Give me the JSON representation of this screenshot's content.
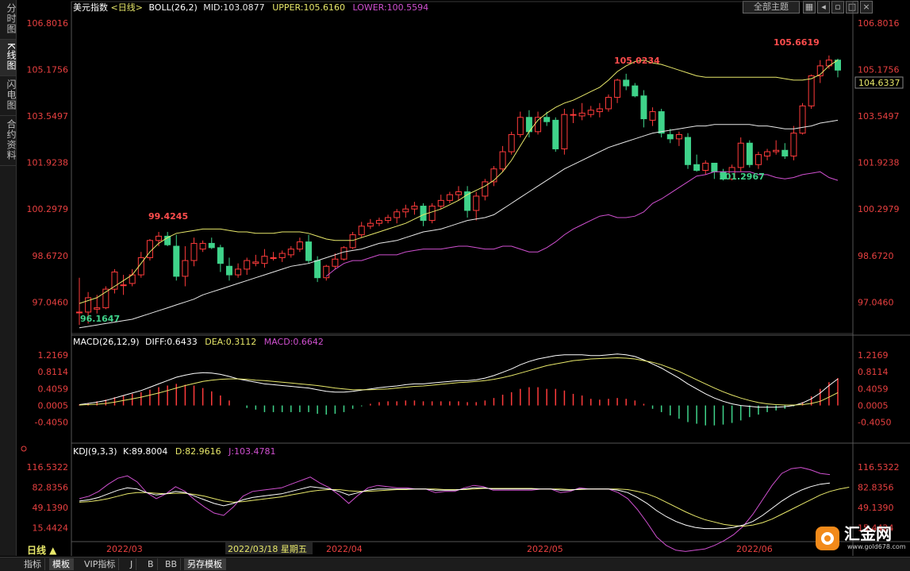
{
  "left_tabs": [
    "分时图",
    "K线图",
    "闪电图",
    "合约资料"
  ],
  "active_left_tab": 1,
  "top_buttons": {
    "theme": "全部主题",
    "icons": [
      "grid-icon",
      "prev-icon",
      "restore-icon",
      "maximize-icon",
      "close-icon"
    ]
  },
  "main_header": {
    "name": "美元指数",
    "period": "<日线>",
    "boll": "BOLL(26,2)",
    "mid": "MID:103.0877",
    "upper": "UPPER:105.6160",
    "lower": "LOWER:100.5594"
  },
  "macd_header": {
    "name": "MACD(26,12,9)",
    "diff": "DIFF:0.6433",
    "dea": "DEA:0.3112",
    "macd": "MACD:0.6642"
  },
  "kdj_header": {
    "name": "KDJ(9,3,3)",
    "k": "K:89.8004",
    "d": "D:82.9616",
    "j": "J:103.4781"
  },
  "annotations": {
    "high1": "99.4245",
    "high2": "105.0234",
    "high3": "105.6619",
    "low1": "96.1647",
    "low2": "101.2967",
    "last_price": "104.6337"
  },
  "x_axis": {
    "period_label": "日线 ▲",
    "months": [
      "2022/03",
      "2022/04",
      "2022/05",
      "2022/06"
    ],
    "cursor_date": "2022/03/18 星期五"
  },
  "bottom_tabs": [
    "指标",
    "模板",
    "VIP指标",
    "J",
    "B",
    "BB",
    "另存模板"
  ],
  "active_bottom_tab": 1,
  "logo": {
    "text": "汇金网",
    "url": "www.gold678.com"
  },
  "colors": {
    "up": "#ff3b3b",
    "down": "#3fd38a",
    "mid": "#e8e8e8",
    "upper": "#e8e86a",
    "lower": "#d050d0",
    "k_line": "#ffffff",
    "d_line": "#e8e86a",
    "j_line": "#d050d0",
    "axis_text": "#e84040"
  },
  "chart_data": [
    {
      "type": "candlestick",
      "title": "美元指数 <日线>",
      "y_ticks": [
        "106.8016",
        "105.1756",
        "103.5497",
        "101.9238",
        "100.2979",
        "98.6720",
        "97.0460"
      ],
      "ylim": [
        95.95,
        107.1
      ],
      "ohlc": [
        [
          96.7,
          97.9,
          96.25,
          96.7
        ],
        [
          96.7,
          97.4,
          96.3,
          97.2
        ],
        [
          96.8,
          97.3,
          96.65,
          96.85
        ],
        [
          96.85,
          97.6,
          96.8,
          97.5
        ],
        [
          97.5,
          98.2,
          97.35,
          98.1
        ],
        [
          97.65,
          98.0,
          97.3,
          97.65
        ],
        [
          97.7,
          98.2,
          97.6,
          98.0
        ],
        [
          98.0,
          98.8,
          97.9,
          98.6
        ],
        [
          98.6,
          99.25,
          98.5,
          99.2
        ],
        [
          99.2,
          99.5,
          99.0,
          99.35
        ],
        [
          99.35,
          99.5,
          99.0,
          99.05
        ],
        [
          99.0,
          99.4,
          97.8,
          97.95
        ],
        [
          97.95,
          99.0,
          97.6,
          98.5
        ],
        [
          98.5,
          99.3,
          98.3,
          99.1
        ],
        [
          98.9,
          99.2,
          98.8,
          99.1
        ],
        [
          99.1,
          99.3,
          98.9,
          98.95
        ],
        [
          98.95,
          99.05,
          98.1,
          98.4
        ],
        [
          98.3,
          98.6,
          97.8,
          98.0
        ],
        [
          98.0,
          98.4,
          97.9,
          98.2
        ],
        [
          98.2,
          98.6,
          98.0,
          98.5
        ],
        [
          98.4,
          98.7,
          98.3,
          98.45
        ],
        [
          98.4,
          98.9,
          98.25,
          98.65
        ],
        [
          98.6,
          98.8,
          98.5,
          98.6
        ],
        [
          98.6,
          98.85,
          98.45,
          98.75
        ],
        [
          98.7,
          99.0,
          98.6,
          98.9
        ],
        [
          98.9,
          99.3,
          98.8,
          99.15
        ],
        [
          99.15,
          99.4,
          98.4,
          98.5
        ],
        [
          98.5,
          98.65,
          97.75,
          97.9
        ],
        [
          97.9,
          98.35,
          97.8,
          98.3
        ],
        [
          98.3,
          98.75,
          98.2,
          98.55
        ],
        [
          98.55,
          99.0,
          98.5,
          98.95
        ],
        [
          98.95,
          99.5,
          98.9,
          99.4
        ],
        [
          99.4,
          99.85,
          99.3,
          99.7
        ],
        [
          99.7,
          99.95,
          99.6,
          99.8
        ],
        [
          99.8,
          100.0,
          99.7,
          99.9
        ],
        [
          99.9,
          100.1,
          99.8,
          100.0
        ],
        [
          100.0,
          100.3,
          99.8,
          100.2
        ],
        [
          100.2,
          100.45,
          100.0,
          100.3
        ],
        [
          100.3,
          100.55,
          100.1,
          100.4
        ],
        [
          100.4,
          100.5,
          99.7,
          99.9
        ],
        [
          99.9,
          100.5,
          99.8,
          100.4
        ],
        [
          100.4,
          100.8,
          100.3,
          100.6
        ],
        [
          100.6,
          100.9,
          100.5,
          100.8
        ],
        [
          100.8,
          101.1,
          100.6,
          100.9
        ],
        [
          100.9,
          101.1,
          100.0,
          100.25
        ],
        [
          100.25,
          100.9,
          99.9,
          100.75
        ],
        [
          100.75,
          101.35,
          100.6,
          101.25
        ],
        [
          101.25,
          101.8,
          101.1,
          101.7
        ],
        [
          101.7,
          102.5,
          101.6,
          102.3
        ],
        [
          102.3,
          103.0,
          102.2,
          102.9
        ],
        [
          102.9,
          103.7,
          102.8,
          103.5
        ],
        [
          103.5,
          103.75,
          102.8,
          103.0
        ],
        [
          103.0,
          103.7,
          102.9,
          103.5
        ],
        [
          103.5,
          103.7,
          103.2,
          103.35
        ],
        [
          103.4,
          103.5,
          102.3,
          102.4
        ],
        [
          102.4,
          103.8,
          102.2,
          103.6
        ],
        [
          103.6,
          103.8,
          103.3,
          103.6
        ],
        [
          103.55,
          104.0,
          103.4,
          103.65
        ],
        [
          103.6,
          103.9,
          103.5,
          103.75
        ],
        [
          103.7,
          104.0,
          103.5,
          103.8
        ],
        [
          103.8,
          104.3,
          103.7,
          104.2
        ],
        [
          104.2,
          104.85,
          104.0,
          104.8
        ],
        [
          104.8,
          105.0234,
          104.45,
          104.6
        ],
        [
          104.6,
          104.7,
          104.2,
          104.25
        ],
        [
          104.25,
          104.45,
          103.15,
          103.45
        ],
        [
          103.4,
          103.85,
          103.2,
          103.7
        ],
        [
          103.7,
          103.8,
          102.8,
          102.95
        ],
        [
          102.9,
          103.1,
          102.6,
          102.75
        ],
        [
          102.75,
          103.0,
          102.5,
          102.9
        ],
        [
          102.8,
          102.95,
          101.7,
          101.85
        ],
        [
          101.85,
          102.2,
          101.6,
          101.65
        ],
        [
          101.65,
          102.0,
          101.5,
          101.9
        ],
        [
          101.9,
          101.9,
          101.35,
          101.6
        ],
        [
          101.6,
          101.7,
          101.2967,
          101.35
        ],
        [
          101.35,
          101.85,
          101.3,
          101.75
        ],
        [
          101.75,
          102.8,
          101.6,
          102.6
        ],
        [
          102.6,
          102.7,
          101.75,
          101.85
        ],
        [
          101.85,
          102.3,
          101.7,
          102.2
        ],
        [
          102.15,
          102.4,
          102.0,
          102.3
        ],
        [
          102.3,
          102.7,
          102.2,
          102.35
        ],
        [
          102.35,
          102.6,
          102.05,
          102.15
        ],
        [
          102.15,
          103.2,
          102.0,
          102.95
        ],
        [
          102.95,
          104.0,
          102.9,
          103.9
        ],
        [
          103.9,
          105.0,
          103.8,
          104.95
        ],
        [
          104.95,
          105.5,
          104.7,
          105.3
        ],
        [
          105.3,
          105.6619,
          105.2,
          105.5
        ],
        [
          105.5,
          105.55,
          104.9,
          105.15
        ]
      ],
      "mid": [
        96.15,
        96.2,
        96.25,
        96.3,
        96.35,
        96.4,
        96.45,
        96.55,
        96.65,
        96.75,
        96.85,
        96.95,
        97.05,
        97.15,
        97.3,
        97.4,
        97.5,
        97.6,
        97.7,
        97.8,
        97.9,
        98.0,
        98.1,
        98.2,
        98.3,
        98.35,
        98.4,
        98.5,
        98.6,
        98.7,
        98.8,
        98.85,
        98.9,
        99.0,
        99.1,
        99.15,
        99.2,
        99.3,
        99.4,
        99.5,
        99.55,
        99.6,
        99.7,
        99.8,
        99.9,
        99.95,
        100.0,
        100.1,
        100.3,
        100.5,
        100.7,
        100.9,
        101.1,
        101.3,
        101.5,
        101.7,
        101.85,
        102.0,
        102.15,
        102.3,
        102.45,
        102.55,
        102.65,
        102.75,
        102.85,
        102.95,
        103.0,
        103.05,
        103.1,
        103.15,
        103.2,
        103.2,
        103.25,
        103.25,
        103.25,
        103.25,
        103.25,
        103.2,
        103.2,
        103.15,
        103.1,
        103.1,
        103.15,
        103.2,
        103.3,
        103.35,
        103.4
      ],
      "upper": [
        97.0,
        97.1,
        97.2,
        97.4,
        97.6,
        97.8,
        98.0,
        98.4,
        98.8,
        99.1,
        99.3,
        99.45,
        99.5,
        99.55,
        99.6,
        99.6,
        99.6,
        99.55,
        99.5,
        99.5,
        99.45,
        99.45,
        99.45,
        99.5,
        99.5,
        99.5,
        99.45,
        99.35,
        99.25,
        99.2,
        99.2,
        99.2,
        99.3,
        99.4,
        99.5,
        99.6,
        99.7,
        99.8,
        99.95,
        100.1,
        100.2,
        100.3,
        100.45,
        100.6,
        100.8,
        100.95,
        101.1,
        101.3,
        101.6,
        102.0,
        102.5,
        103.0,
        103.4,
        103.65,
        103.85,
        104.0,
        104.1,
        104.25,
        104.4,
        104.55,
        104.8,
        105.1,
        105.3,
        105.45,
        105.5,
        105.4,
        105.35,
        105.25,
        105.15,
        105.05,
        104.95,
        104.9,
        104.9,
        104.9,
        104.9,
        104.9,
        104.9,
        104.9,
        104.9,
        104.9,
        104.85,
        104.8,
        104.8,
        104.85,
        105.0,
        105.3,
        105.5
      ],
      "lower": [
        null,
        null,
        null,
        null,
        null,
        null,
        null,
        null,
        null,
        null,
        null,
        null,
        null,
        null,
        null,
        null,
        null,
        null,
        null,
        null,
        null,
        null,
        null,
        null,
        null,
        null,
        null,
        null,
        null,
        null,
        null,
        null,
        null,
        null,
        null,
        null,
        null,
        null,
        null,
        null,
        null,
        null,
        null,
        null,
        null,
        null,
        null,
        null,
        null,
        null,
        null,
        null,
        null,
        null,
        null,
        null,
        null,
        null,
        null,
        null,
        null,
        null,
        null,
        null,
        null,
        null,
        null,
        null,
        null,
        null,
        null,
        null,
        null,
        null,
        null,
        null,
        null,
        null,
        null,
        null,
        null,
        null,
        null,
        null,
        null,
        null,
        null
      ]
    },
    {
      "type": "line",
      "title": "MACD(26,12,9)",
      "y_ticks": [
        "1.2169",
        "0.8114",
        "0.4059",
        "0.0005",
        "-0.4050"
      ],
      "ylim": [
        -0.85,
        1.35
      ],
      "diff": [
        0.02,
        0.05,
        0.08,
        0.12,
        0.18,
        0.24,
        0.3,
        0.36,
        0.44,
        0.52,
        0.6,
        0.68,
        0.73,
        0.77,
        0.79,
        0.78,
        0.75,
        0.7,
        0.64,
        0.6,
        0.56,
        0.52,
        0.5,
        0.48,
        0.46,
        0.44,
        0.42,
        0.38,
        0.34,
        0.32,
        0.32,
        0.34,
        0.37,
        0.4,
        0.43,
        0.45,
        0.47,
        0.5,
        0.52,
        0.52,
        0.54,
        0.56,
        0.58,
        0.6,
        0.6,
        0.62,
        0.66,
        0.72,
        0.8,
        0.88,
        0.98,
        1.06,
        1.12,
        1.16,
        1.2,
        1.22,
        1.22,
        1.22,
        1.2,
        1.2,
        1.22,
        1.24,
        1.22,
        1.18,
        1.1,
        1.0,
        0.9,
        0.78,
        0.66,
        0.52,
        0.4,
        0.28,
        0.18,
        0.1,
        0.04,
        0.0,
        -0.02,
        -0.04,
        -0.04,
        -0.04,
        -0.03,
        0.0,
        0.06,
        0.16,
        0.3,
        0.48,
        0.64
      ],
      "dea": [
        0.01,
        0.02,
        0.03,
        0.05,
        0.08,
        0.12,
        0.16,
        0.2,
        0.25,
        0.3,
        0.36,
        0.42,
        0.48,
        0.53,
        0.58,
        0.61,
        0.63,
        0.64,
        0.64,
        0.63,
        0.61,
        0.6,
        0.58,
        0.56,
        0.54,
        0.52,
        0.5,
        0.48,
        0.45,
        0.42,
        0.4,
        0.38,
        0.38,
        0.38,
        0.39,
        0.4,
        0.42,
        0.44,
        0.46,
        0.47,
        0.49,
        0.51,
        0.53,
        0.55,
        0.56,
        0.58,
        0.6,
        0.63,
        0.67,
        0.72,
        0.78,
        0.84,
        0.9,
        0.96,
        1.0,
        1.04,
        1.08,
        1.1,
        1.12,
        1.13,
        1.14,
        1.15,
        1.14,
        1.12,
        1.08,
        1.04,
        0.98,
        0.9,
        0.82,
        0.72,
        0.62,
        0.52,
        0.42,
        0.33,
        0.25,
        0.18,
        0.12,
        0.07,
        0.04,
        0.02,
        0.01,
        0.01,
        0.02,
        0.05,
        0.1,
        0.2,
        0.31
      ]
    },
    {
      "type": "line",
      "title": "KDJ(9,3,3)",
      "y_ticks": [
        "116.5322",
        "82.8356",
        "49.1390",
        "15.4424"
      ],
      "ylim": [
        -5,
        130
      ],
      "k": [
        60,
        62,
        66,
        72,
        78,
        82,
        80,
        74,
        70,
        72,
        76,
        74,
        68,
        62,
        56,
        52,
        56,
        62,
        66,
        68,
        70,
        72,
        76,
        80,
        84,
        82,
        80,
        76,
        70,
        74,
        78,
        80,
        80,
        80,
        80,
        80,
        80,
        78,
        78,
        78,
        80,
        82,
        82,
        80,
        80,
        80,
        80,
        80,
        80,
        80,
        78,
        78,
        80,
        80,
        80,
        80,
        78,
        74,
        66,
        56,
        44,
        34,
        26,
        20,
        16,
        14,
        14,
        14,
        16,
        20,
        26,
        36,
        48,
        60,
        70,
        78,
        84,
        88,
        90
      ],
      "d": [
        58,
        59,
        61,
        64,
        68,
        72,
        74,
        74,
        73,
        72,
        73,
        73,
        71,
        68,
        64,
        60,
        58,
        59,
        61,
        63,
        65,
        67,
        70,
        73,
        76,
        78,
        79,
        79,
        77,
        76,
        76,
        77,
        78,
        79,
        79,
        80,
        80,
        80,
        79,
        79,
        79,
        80,
        81,
        81,
        81,
        81,
        81,
        81,
        80,
        80,
        80,
        79,
        79,
        80,
        80,
        80,
        80,
        79,
        76,
        72,
        66,
        58,
        50,
        42,
        35,
        29,
        25,
        21,
        19,
        18,
        20,
        24,
        30,
        38,
        46,
        54,
        62,
        70,
        76,
        80,
        83
      ],
      "j": [
        64,
        68,
        76,
        88,
        98,
        102,
        92,
        74,
        64,
        72,
        84,
        76,
        62,
        50,
        40,
        36,
        50,
        68,
        76,
        78,
        80,
        82,
        88,
        94,
        100,
        90,
        82,
        70,
        56,
        70,
        82,
        86,
        84,
        82,
        82,
        80,
        80,
        74,
        76,
        76,
        82,
        86,
        84,
        78,
        78,
        78,
        78,
        78,
        80,
        80,
        74,
        76,
        82,
        80,
        80,
        80,
        74,
        64,
        46,
        24,
        0,
        -14,
        -22,
        -24,
        -22,
        -20,
        -14,
        -6,
        4,
        18,
        38,
        62,
        86,
        106,
        114,
        116,
        112,
        106,
        104
      ]
    }
  ]
}
